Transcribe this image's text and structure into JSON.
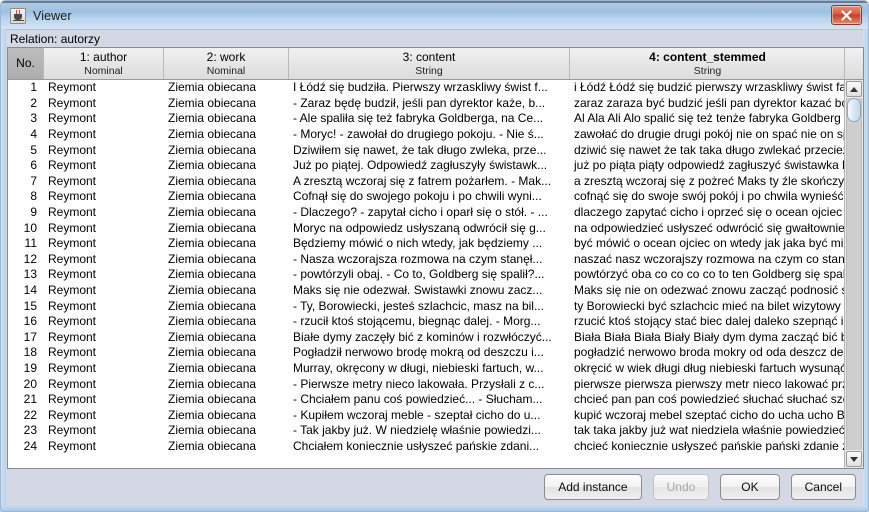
{
  "window": {
    "title": "Viewer",
    "icon": "java-coffee-cup-icon",
    "close_label": "close-icon",
    "accent_title_bar": "#9dc0e2",
    "close_button_color": "#c64026"
  },
  "relation": {
    "label": "Relation: autorzy"
  },
  "table": {
    "columns": [
      {
        "name": "No.",
        "type": "",
        "bold": false,
        "align": "right"
      },
      {
        "name": "1: author",
        "type": "Nominal",
        "bold": false,
        "align": "left"
      },
      {
        "name": "2: work",
        "type": "Nominal",
        "bold": false,
        "align": "left"
      },
      {
        "name": "3: content",
        "type": "String",
        "bold": false,
        "align": "left"
      },
      {
        "name": "4: content_stemmed",
        "type": "String",
        "bold": true,
        "align": "left"
      }
    ],
    "rows": [
      {
        "no": "1",
        "author": "Reymont",
        "work": "Ziemia obiecana",
        "content": "I Łódź się budziła. Pierwszy wrzaskliwy świst f...",
        "content_stemmed": "i Łódź Łódź się budzić pierwszy wrzaskliwy świst fabr..."
      },
      {
        "no": "2",
        "author": "Reymont",
        "work": "Ziemia obiecana",
        "content": "- Zaraz będę budził, jeśli pan dyrektor każe, b...",
        "content_stemmed": "zaraz zaraza być budzić jeśli pan dyrektor kazać bo p..."
      },
      {
        "no": "3",
        "author": "Reymont",
        "work": "Ziemia obiecana",
        "content": "- Ale spaliła się też fabryka Goldberga, na Ce...",
        "content_stemmed": "Al Ala Ali Alo spalić się też tenże fabryka Goldberg na..."
      },
      {
        "no": "4",
        "author": "Reymont",
        "work": "Ziemia obiecana",
        "content": "- Moryc! - zawołał do drugiego pokoju. - Nie ś...",
        "content_stemmed": "zawołać do drugie drugi pokój nie on spać nie on sp..."
      },
      {
        "no": "5",
        "author": "Reymont",
        "work": "Ziemia obiecana",
        "content": "Dziwiłem się nawet, że tak długo zwleka, prze...",
        "content_stemmed": "dziwić się nawet że tak taka długo zwlekać przecież p..."
      },
      {
        "no": "6",
        "author": "Reymont",
        "work": "Ziemia obiecana",
        "content": "Już po piątej. Odpowiedź zagłuszyły świstawk...",
        "content_stemmed": "już po piąta piąty odpowiedź zagłuszyć świstawka kt..."
      },
      {
        "no": "7",
        "author": "Reymont",
        "work": "Ziemia obiecana",
        "content": "A zresztą wczoraj się z fatrem pożarłem. - Mak...",
        "content_stemmed": "a zresztą wczoraj się z pożreć Maks ty źle skończyć pr..."
      },
      {
        "no": "8",
        "author": "Reymont",
        "work": "Ziemia obiecana",
        "content": "Cofnął się do swojego pokoju i po chwili wyni...",
        "content_stemmed": "cofnąć się do swoje swój pokój i po chwila wynieść ..."
      },
      {
        "no": "9",
        "author": "Reymont",
        "work": "Ziemia obiecana",
        "content": "- Dlaczego? - zapytał cicho i oparł się o stół. - ...",
        "content_stemmed": "dlaczego zapytać cicho i oprzeć się o ocean ojciec st..."
      },
      {
        "no": "10",
        "author": "Reymont",
        "work": "Ziemia obiecana",
        "content": "Moryc na odpowiedz usłyszaną odwrócił się g...",
        "content_stemmed": "na odpowiedzieć usłyszeć odwrócić się gwałtownie ..."
      },
      {
        "no": "11",
        "author": "Reymont",
        "work": "Ziemia obiecana",
        "content": "Będziemy mówić o nich wtedy, jak będziemy ...",
        "content_stemmed": "być mówić o ocean ojciec on wtedy jak jaka być mieli..."
      },
      {
        "no": "12",
        "author": "Reymont",
        "work": "Ziemia obiecana",
        "content": "- Nasza wczorajsza rozmowa na czym stanęł...",
        "content_stemmed": "naszać nasz wczorajszy rozmowa na czym co stanąć..."
      },
      {
        "no": "13",
        "author": "Reymont",
        "work": "Ziemia obiecana",
        "content": "- powtórzyli obaj. - Co to, Goldberg się spalił?...",
        "content_stemmed": "powtórzyć oba co co co co to ten Goldberg się spalić..."
      },
      {
        "no": "14",
        "author": "Reymont",
        "work": "Ziemia obiecana",
        "content": "Maks się nie odezwał. Swistawki znowu zacz...",
        "content_stemmed": "Maks się nie on odezwać znowu zacząć podnosić s..."
      },
      {
        "no": "15",
        "author": "Reymont",
        "work": "Ziemia obiecana",
        "content": "- Ty, Borowiecki, jesteś szlachcic, masz na bil...",
        "content_stemmed": "ty Borowiecki być szlachcic mieć na bilet wizytowy he..."
      },
      {
        "no": "16",
        "author": "Reymont",
        "work": "Ziemia obiecana",
        "content": "- rzucił ktoś stojącemu, biegnąc dalej. - Morg...",
        "content_stemmed": "rzucić ktoś stojący stać biec dalej daleko szepnąć i p..."
      },
      {
        "no": "17",
        "author": "Reymont",
        "work": "Ziemia obiecana",
        "content": "Białe dymy zaczęły bić z kominów i rozwłóczyć...",
        "content_stemmed": "Biała Biała Biała Biały Biały dym dyma zacząć bić bic..."
      },
      {
        "no": "18",
        "author": "Reymont",
        "work": "Ziemia obiecana",
        "content": "Pogładził nerwowo brodę mokrą od deszczu i...",
        "content_stemmed": "pogładzić nerwowo broda mokry od oda deszcz desz..."
      },
      {
        "no": "19",
        "author": "Reymont",
        "work": "Ziemia obiecana",
        "content": "Murray, okręcony w długi, niebieski fartuch, w...",
        "content_stemmed": "okręcić w wiek długi dług niebieski fartuch wysunąć ..."
      },
      {
        "no": "20",
        "author": "Reymont",
        "work": "Ziemia obiecana",
        "content": "- Pierwsze metry nieco lakowała. Przysłali z c...",
        "content_stemmed": "pierwsze pierwsza pierwszy metr nieco lakować przy..."
      },
      {
        "no": "21",
        "author": "Reymont",
        "work": "Ziemia obiecana",
        "content": "- Chciałem panu coś powiedzieć... - Słucham...",
        "content_stemmed": "chcieć pan pan coś powiedzieć słuchać słuchać sze..."
      },
      {
        "no": "22",
        "author": "Reymont",
        "work": "Ziemia obiecana",
        "content": "- Kupiłem wczoraj meble - szeptał cicho do u...",
        "content_stemmed": "kupić wczoraj mebel szeptać cicho do ucha ucho Bo..."
      },
      {
        "no": "23",
        "author": "Reymont",
        "work": "Ziemia obiecana",
        "content": "- Tak jakby już. W niedzielę właśnie powiedzi...",
        "content_stemmed": "tak taka jakby już wat niedziela właśnie powiedzieć ..."
      },
      {
        "no": "24",
        "author": "Reymont",
        "work": "Ziemia obiecana",
        "content": "Chciałem koniecznie usłyszeć pańskie zdani...",
        "content_stemmed": "chcieć koniecznie usłyszeć pańskie pański zdanie z..."
      }
    ]
  },
  "scrollbar": {
    "up_arrow": "scroll-up-icon",
    "down_arrow": "scroll-down-icon"
  },
  "buttons": {
    "add_instance": "Add instance",
    "undo": "Undo",
    "ok": "OK",
    "cancel": "Cancel",
    "undo_disabled": true
  }
}
